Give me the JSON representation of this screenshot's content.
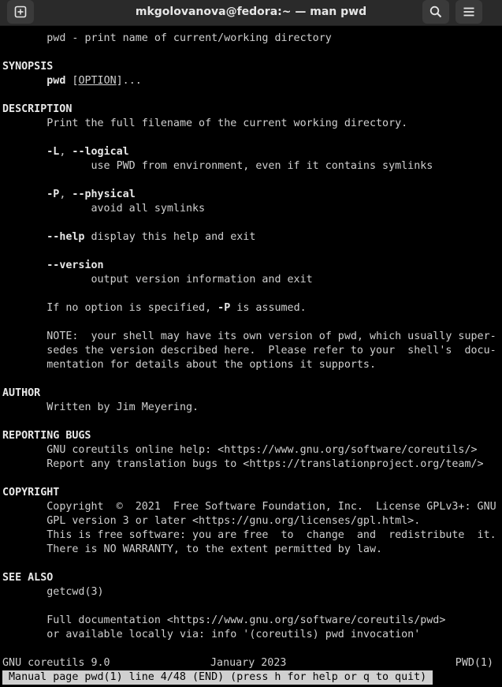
{
  "window": {
    "title": "mkgolovanova@fedora:~ — man pwd"
  },
  "icons": {
    "new_tab": "new-tab-icon",
    "search": "search-icon",
    "menu": "hamburger-menu-icon"
  },
  "colors": {
    "titlebar": "#2a2a2a",
    "terminal_bg": "#000000",
    "terminal_fg": "#d0d0d0",
    "status_bg": "#d0d0d0"
  },
  "man": {
    "name_line": "pwd - print name of current/working directory",
    "synopsis": {
      "heading": "SYNOPSIS",
      "cmd": "pwd",
      "space": " [",
      "option": "OPTION",
      "tail": "]..."
    },
    "description": {
      "heading": "DESCRIPTION",
      "intro": "Print the full filename of the current working directory.",
      "logical_short": "-L",
      "sep1": ", ",
      "logical_long": "--logical",
      "logical_desc": "use PWD from environment, even if it contains symlinks",
      "physical_short": "-P",
      "sep2": ", ",
      "physical_long": "--physical",
      "physical_desc": "avoid all symlinks",
      "help_opt": "--help",
      "help_desc": " display this help and exit",
      "version_opt": "--version",
      "version_desc": "output version information and exit",
      "default_pre": "If no option is specified, ",
      "default_opt": "-P",
      "default_post": " is assumed.",
      "note_1": "NOTE:  your shell may have its own version of pwd, which usually super-",
      "note_2": "sedes the version described here.  Please refer to your  shell's  docu-",
      "note_3": "mentation for details about the options it supports."
    },
    "author": {
      "heading": "AUTHOR",
      "text": "Written by Jim Meyering."
    },
    "bugs": {
      "heading": "REPORTING BUGS",
      "line1": "GNU coreutils online help: <https://www.gnu.org/software/coreutils/>",
      "line2": "Report any translation bugs to <https://translationproject.org/team/>"
    },
    "copyright": {
      "heading": "COPYRIGHT",
      "line1": "Copyright  ©  2021  Free Software Foundation, Inc.  License GPLv3+: GNU",
      "line2": "GPL version 3 or later <https://gnu.org/licenses/gpl.html>.",
      "line3": "This is free software: you are free  to  change  and  redistribute  it.",
      "line4": "There is NO WARRANTY, to the extent permitted by law."
    },
    "see_also": {
      "heading": "SEE ALSO",
      "ref": "getcwd(3)",
      "line1": "Full documentation <https://www.gnu.org/software/coreutils/pwd>",
      "line2": "or available locally via: info '(coreutils) pwd invocation'"
    },
    "footer": {
      "left": "GNU coreutils 9.0",
      "center": "January 2023",
      "right": "PWD(1)"
    },
    "status": "Manual page pwd(1) line 4/48 (END) (press h for help or q to quit)"
  }
}
